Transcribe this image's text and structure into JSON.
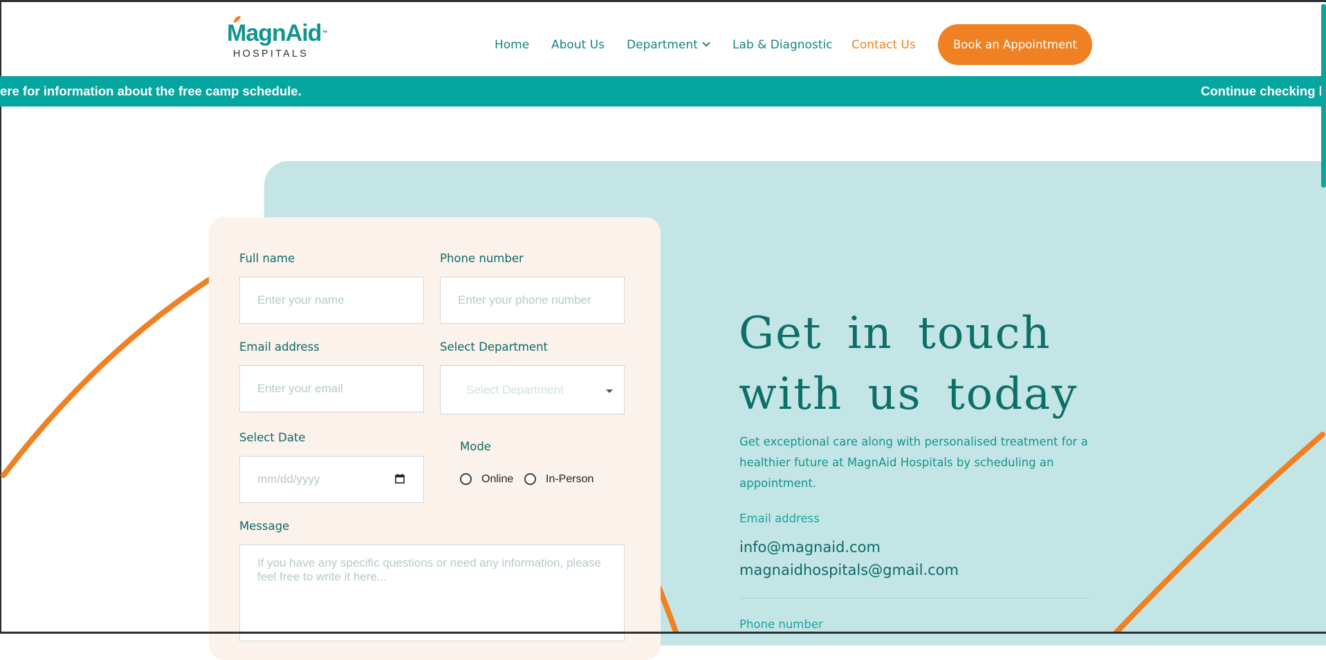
{
  "brand": {
    "name_part1": "Magn",
    "name_part2": "Aid",
    "trademark": "™",
    "subtitle": "HOSPITALS",
    "colors": {
      "teal": "#12958f",
      "orange": "#ef8122",
      "ticker": "#05a5a0",
      "panel": "#c4e5e5",
      "card": "#fcf2ec"
    }
  },
  "nav": {
    "items": [
      {
        "label": "Home",
        "active": false
      },
      {
        "label": "About Us",
        "active": false
      },
      {
        "label": "Department",
        "active": false,
        "has_dropdown": true
      },
      {
        "label": "Lab & Diagnostic",
        "active": false
      },
      {
        "label": "Contact Us",
        "active": true
      }
    ],
    "cta_label": "Book an Appointment"
  },
  "ticker": {
    "segment_1": "ere for information about the free camp schedule.",
    "segment_2": "Continue checking he"
  },
  "form": {
    "full_name": {
      "label": "Full name",
      "placeholder": "Enter your name"
    },
    "phone": {
      "label": "Phone number",
      "placeholder": "Enter your phone number"
    },
    "email": {
      "label": "Email address",
      "placeholder": "Enter your email"
    },
    "department": {
      "label": "Select Department",
      "placeholder": "Select Department"
    },
    "date": {
      "label": "Select Date",
      "placeholder": "mm/dd/yyyy",
      "icon": "calendar-icon"
    },
    "mode": {
      "label": "Mode",
      "options": [
        "Online",
        "In-Person"
      ]
    },
    "message": {
      "label": "Message",
      "placeholder": "If you have any specific questions or need any information, please feel free to write it here..."
    }
  },
  "contact": {
    "headline_line1": "Get in touch",
    "headline_line2": "with us today",
    "intro": "Get exceptional care along with personalised treatment for a healthier future at MagnAid Hospitals by scheduling an appointment.",
    "email_label": "Email address",
    "email_1": "info@magnaid.com",
    "email_2": "magnaidhospitals@gmail.com",
    "phone_label": "Phone number"
  }
}
